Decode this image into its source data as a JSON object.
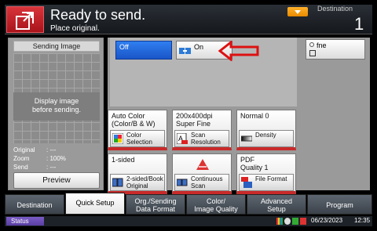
{
  "header": {
    "title": "Ready to send.",
    "subtitle": "Place original.",
    "destination_label": "Destination",
    "destination_count": "1"
  },
  "left_panel": {
    "sending_image_label": "Sending Image",
    "display_message_line1": "Display image",
    "display_message_line2": "before sending.",
    "info": [
      {
        "label": "Original",
        "value": ": ---"
      },
      {
        "label": "Zoom",
        "value": ": 100%"
      },
      {
        "label": "Send",
        "value": ": ---"
      }
    ],
    "preview_button": "Preview"
  },
  "toggle": {
    "off_label": "Off",
    "on_label": "On",
    "selected": "Off"
  },
  "fine_button": {
    "label": "fne"
  },
  "tiles": [
    {
      "top_line1": "Auto Color",
      "top_line2": "(Color/B & W)",
      "bottom_line1": "Color",
      "bottom_line2": "Selection",
      "icon": "color-selection-icon"
    },
    {
      "top_line1": "200x400dpi",
      "top_line2": "Super Fine",
      "bottom_line1": "Scan",
      "bottom_line2": "Resolution",
      "icon": "scan-resolution-icon"
    },
    {
      "top_line1": "Normal 0",
      "top_line2": "",
      "bottom_line1": "Density",
      "bottom_line2": "",
      "icon": "density-icon"
    },
    {
      "top_line1": "1-sided",
      "top_line2": "",
      "bottom_line1": "2-sided/Book",
      "bottom_line2": "Original",
      "icon": "duplex-original-icon"
    },
    {
      "top_line1": "",
      "top_line2": "",
      "bottom_line1": "Continuous",
      "bottom_line2": "Scan",
      "icon": "continuous-scan-icon"
    },
    {
      "top_line1": "PDF",
      "top_line2": "Quality 1",
      "bottom_line1": "File Format",
      "bottom_line2": "",
      "icon": "file-format-icon"
    }
  ],
  "tabs": [
    {
      "line1": "Destination",
      "line2": ""
    },
    {
      "line1": "Quick Setup",
      "line2": ""
    },
    {
      "line1": "Org./Sending",
      "line2": "Data Format"
    },
    {
      "line1": "Color/",
      "line2": "Image Quality"
    },
    {
      "line1": "Advanced",
      "line2": "Setup"
    },
    {
      "line1": "Program",
      "line2": ""
    }
  ],
  "active_tab": "Quick Setup",
  "status_bar": {
    "status_button": "Status",
    "date": "06/23/2023",
    "time": "12:35"
  },
  "colors": {
    "accent_red": "#c92a2a",
    "selected_blue": "#1a55c8",
    "status_purple": "#5a3ea4",
    "destination_orange": "#e98a00"
  }
}
